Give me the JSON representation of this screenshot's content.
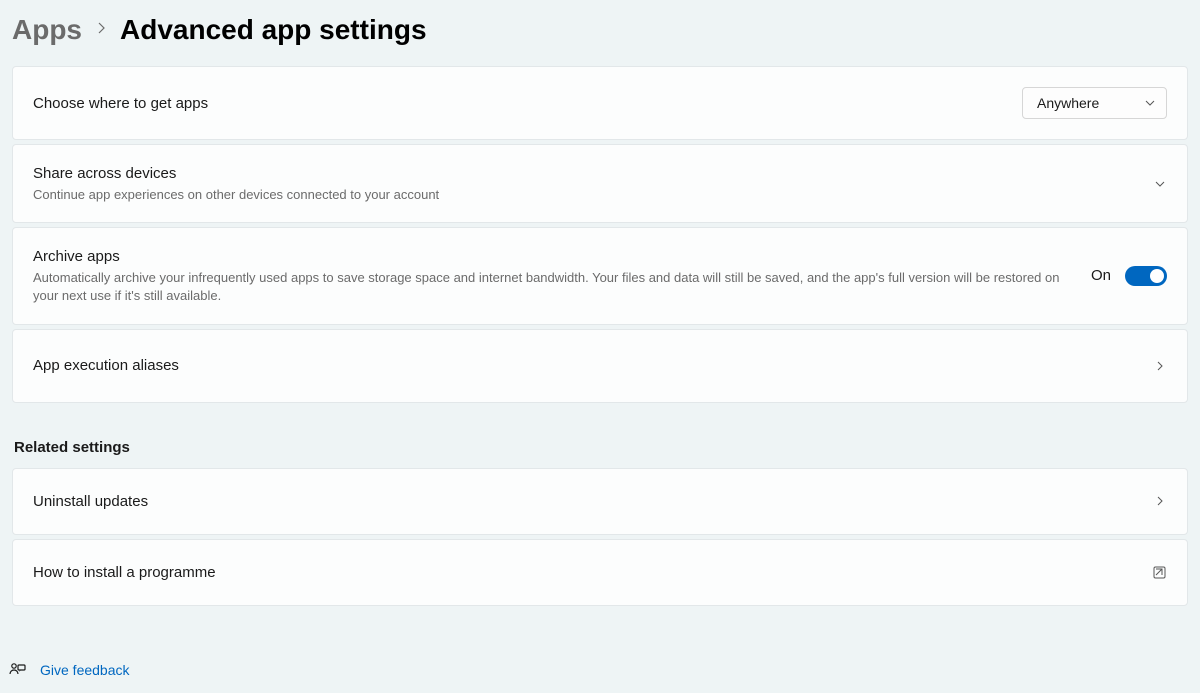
{
  "breadcrumb": {
    "parent": "Apps",
    "current": "Advanced app settings"
  },
  "settings": {
    "chooseWhere": {
      "title": "Choose where to get apps",
      "dropdown": {
        "selected": "Anywhere"
      }
    },
    "shareAcross": {
      "title": "Share across devices",
      "subtitle": "Continue app experiences on other devices connected to your account"
    },
    "archiveApps": {
      "title": "Archive apps",
      "subtitle": "Automatically archive your infrequently used apps to save storage space and internet bandwidth. Your files and data will still be saved, and the app's full version will be restored on your next use if it's still available.",
      "toggleLabel": "On",
      "toggleState": true
    },
    "appExecAliases": {
      "title": "App execution aliases"
    }
  },
  "related": {
    "heading": "Related settings",
    "uninstallUpdates": {
      "title": "Uninstall updates"
    },
    "howToInstall": {
      "title": "How to install a programme"
    }
  },
  "feedback": {
    "label": "Give feedback"
  }
}
